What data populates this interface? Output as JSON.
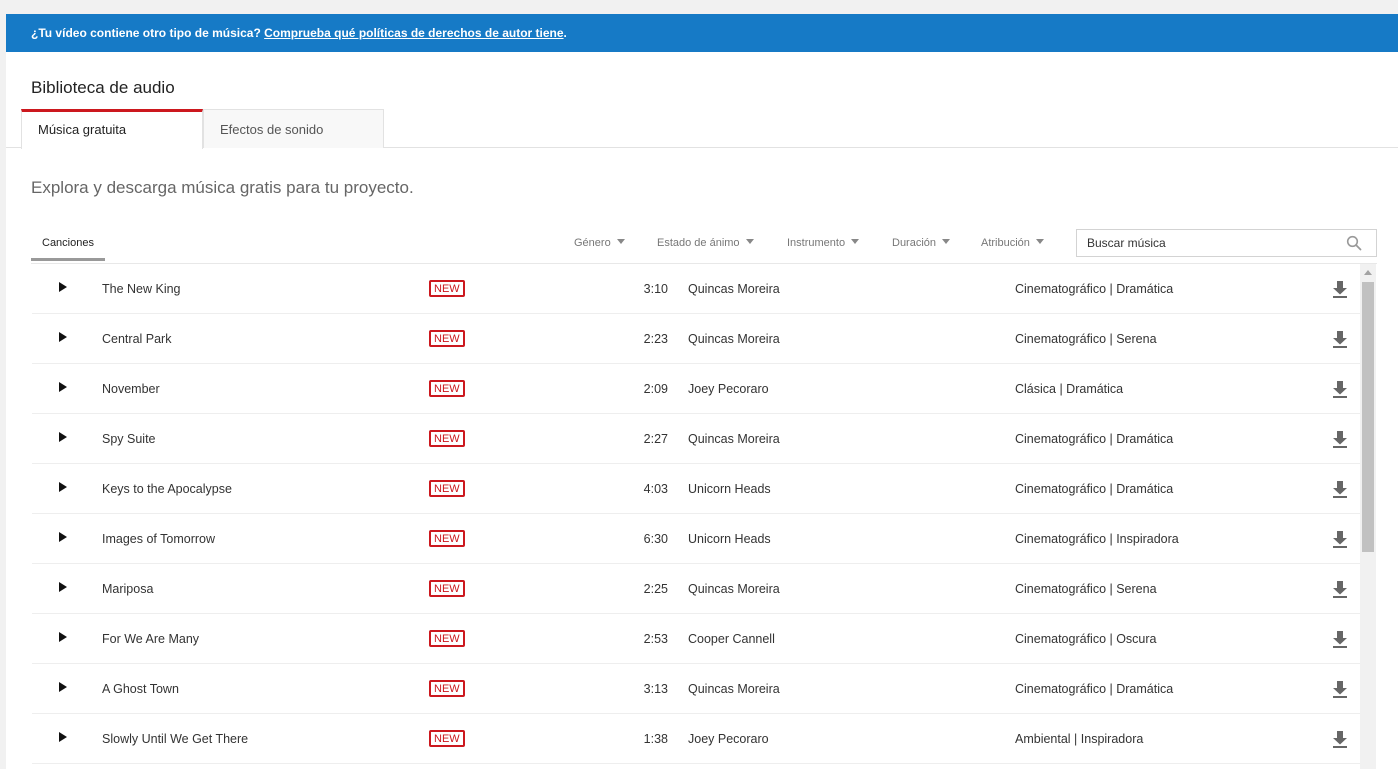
{
  "banner": {
    "text": "¿Tu vídeo contiene otro tipo de música? ",
    "link": "Comprueba qué políticas de derechos de autor tiene",
    "suffix": "."
  },
  "page_title": "Biblioteca de audio",
  "tabs": [
    {
      "label": "Música gratuita",
      "active": true
    },
    {
      "label": "Efectos de sonido",
      "active": false
    }
  ],
  "subtitle": "Explora y descarga música gratis para tu proyecto.",
  "filters": {
    "songs_tab": "Canciones",
    "genre": "Género",
    "mood": "Estado de ánimo",
    "instrument": "Instrumento",
    "duration": "Duración",
    "attribution": "Atribución"
  },
  "search": {
    "placeholder": "Buscar música"
  },
  "colors": {
    "accent": "#cc181e",
    "banner": "#167ac6"
  },
  "tracks": [
    {
      "title": "The New King",
      "badge": "NEW",
      "duration": "3:10",
      "artist": "Quincas Moreira",
      "genre": "Cinematográfico | Dramática"
    },
    {
      "title": "Central Park",
      "badge": "NEW",
      "duration": "2:23",
      "artist": "Quincas Moreira",
      "genre": "Cinematográfico | Serena"
    },
    {
      "title": "November",
      "badge": "NEW",
      "duration": "2:09",
      "artist": "Joey Pecoraro",
      "genre": "Clásica | Dramática"
    },
    {
      "title": "Spy Suite",
      "badge": "NEW",
      "duration": "2:27",
      "artist": "Quincas Moreira",
      "genre": "Cinematográfico | Dramática"
    },
    {
      "title": "Keys to the Apocalypse",
      "badge": "NEW",
      "duration": "4:03",
      "artist": "Unicorn Heads",
      "genre": "Cinematográfico | Dramática"
    },
    {
      "title": "Images of Tomorrow",
      "badge": "NEW",
      "duration": "6:30",
      "artist": "Unicorn Heads",
      "genre": "Cinematográfico | Inspiradora"
    },
    {
      "title": "Mariposa",
      "badge": "NEW",
      "duration": "2:25",
      "artist": "Quincas Moreira",
      "genre": "Cinematográfico | Serena"
    },
    {
      "title": "For We Are Many",
      "badge": "NEW",
      "duration": "2:53",
      "artist": "Cooper Cannell",
      "genre": "Cinematográfico | Oscura"
    },
    {
      "title": "A Ghost Town",
      "badge": "NEW",
      "duration": "3:13",
      "artist": "Quincas Moreira",
      "genre": "Cinematográfico | Dramática"
    },
    {
      "title": "Slowly Until We Get There",
      "badge": "NEW",
      "duration": "1:38",
      "artist": "Joey Pecoraro",
      "genre": "Ambiental | Inspiradora"
    }
  ],
  "icons": {
    "play": "play-icon",
    "download": "download-icon",
    "search": "search-icon",
    "dropdown": "caret-down-icon"
  }
}
